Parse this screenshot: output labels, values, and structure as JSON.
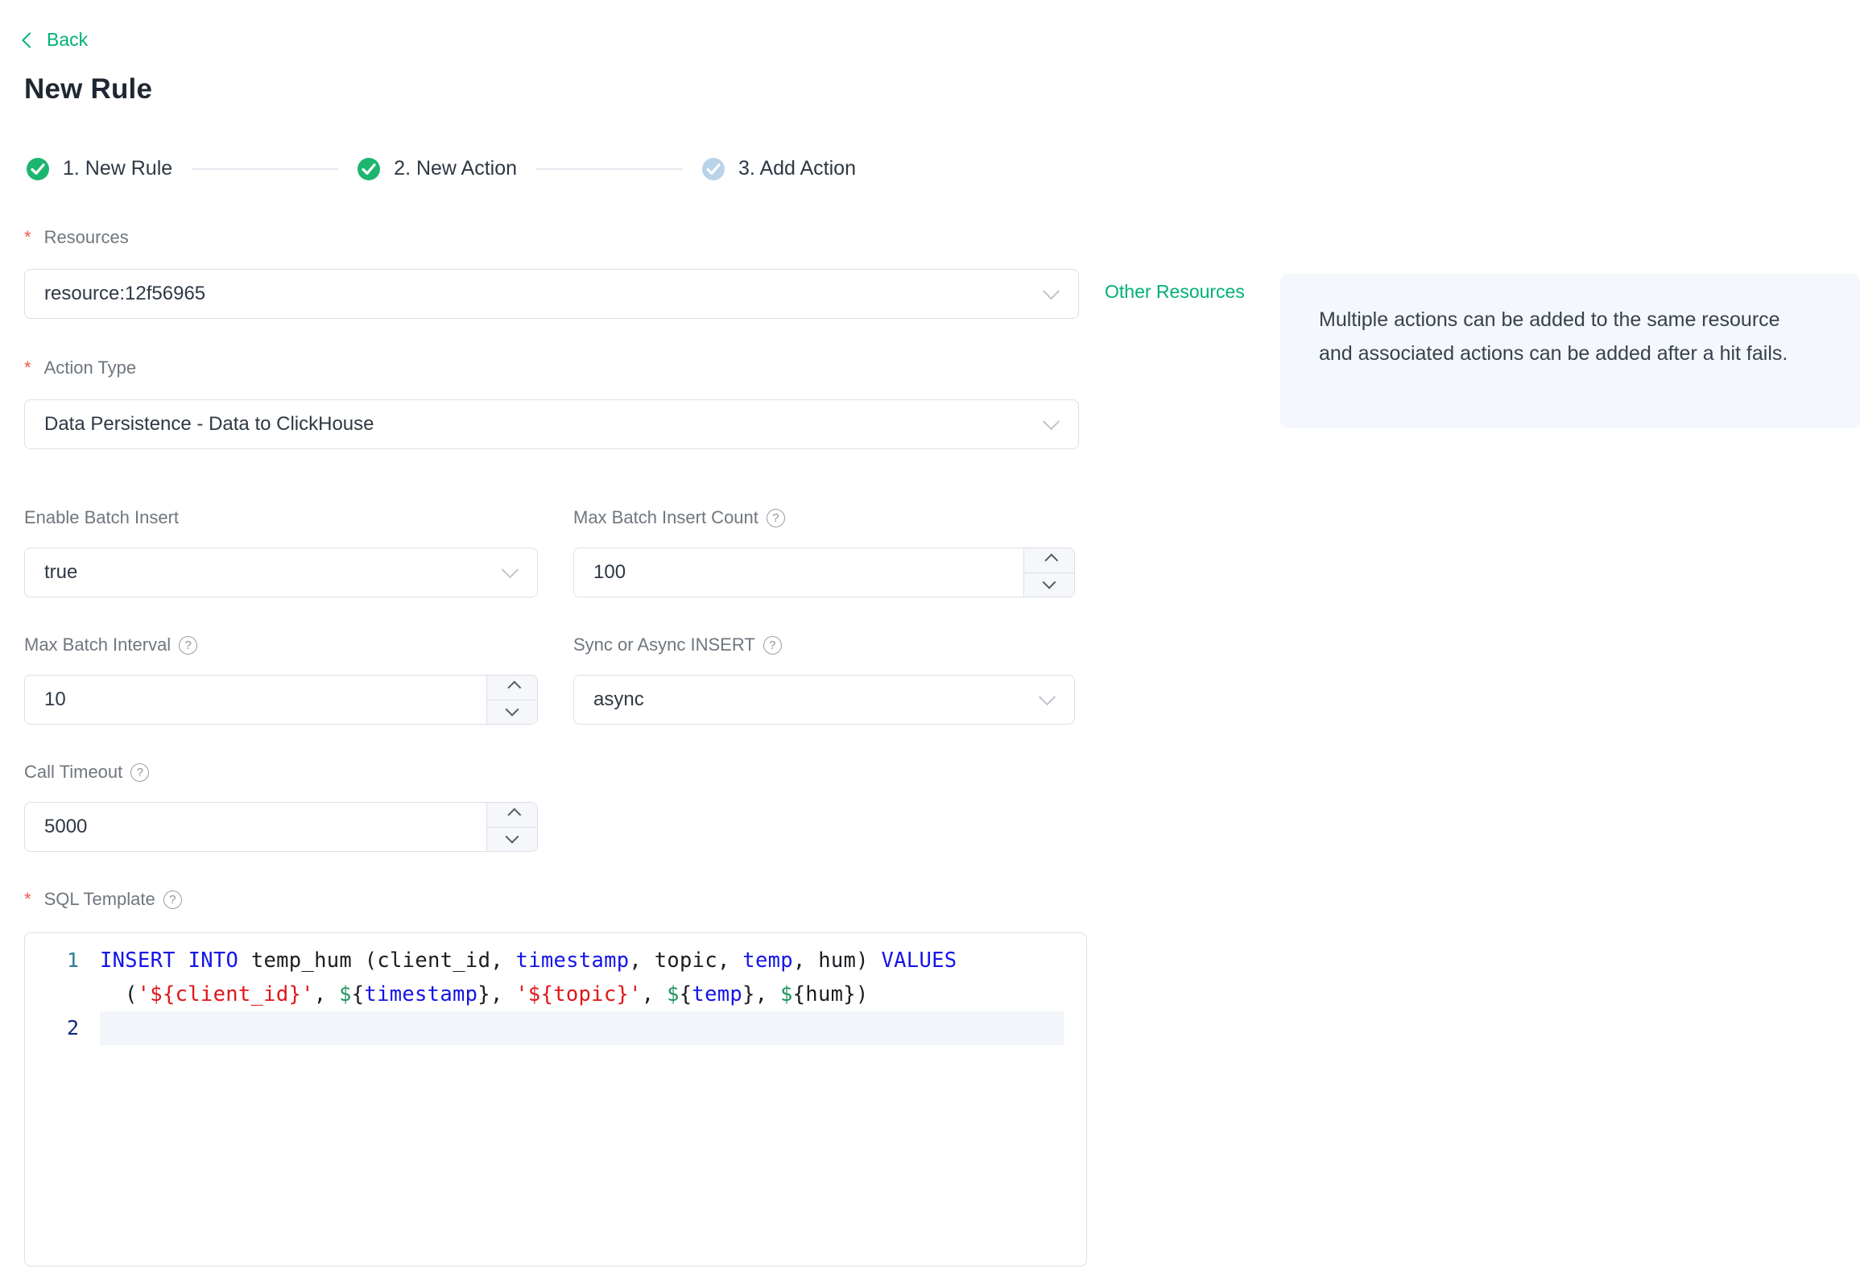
{
  "colors": {
    "accent": "#00b173",
    "step_done": "#1db56f",
    "step_pending": "#b9d3e8",
    "required": "#f0574a",
    "label": "#6f767e",
    "text_dark": "#1f2732",
    "border": "#dcdfe6",
    "chevron": "#c0c4cc",
    "stepper_bg": "#f5f7fa",
    "info_bg": "#f4f7fb",
    "info_text": "#38414d",
    "code_keyword": "#1414e8",
    "code_string": "#e01619",
    "code_variable": "#23945f",
    "code_text": "#1a1d21",
    "line_number": "#2f7f95",
    "line_number_active": "#10297a",
    "active_line_bg": "#f2f6fa"
  },
  "header": {
    "back_label": "Back",
    "title": "New Rule"
  },
  "steps": [
    {
      "label": "1. New Rule",
      "state": "done"
    },
    {
      "label": "2. New Action",
      "state": "done"
    },
    {
      "label": "3. Add Action",
      "state": "pending"
    }
  ],
  "form": {
    "resources": {
      "label": "Resources",
      "value": "resource:12f56965",
      "other_link": "Other Resources"
    },
    "info_box": {
      "text": "Multiple actions can be added to the same resource and associated actions can be added after a hit fails."
    },
    "action_type": {
      "label": "Action Type",
      "value": "Data Persistence - Data to ClickHouse"
    },
    "enable_batch_insert": {
      "label": "Enable Batch Insert",
      "value": "true"
    },
    "max_batch_insert_count": {
      "label": "Max Batch Insert Count",
      "value": "100"
    },
    "max_batch_interval": {
      "label": "Max Batch Interval",
      "value": "10"
    },
    "sync_async": {
      "label": "Sync or Async INSERT",
      "value": "async"
    },
    "call_timeout": {
      "label": "Call Timeout",
      "value": "5000"
    },
    "sql_template": {
      "label": "SQL Template"
    }
  },
  "sql_editor": {
    "rows": [
      {
        "gutter": "1",
        "gutter_class": "ln-default",
        "wrap": false,
        "active": false,
        "tokens": [
          [
            "kw",
            "INSERT INTO"
          ],
          [
            "pl",
            " temp_hum (client_id, "
          ],
          [
            "kw",
            "timestamp"
          ],
          [
            "pl",
            ", topic, "
          ],
          [
            "kw",
            "temp"
          ],
          [
            "pl",
            ", hum) "
          ],
          [
            "kw",
            "VALUES"
          ]
        ]
      },
      {
        "gutter": "",
        "gutter_class": "ln-default",
        "wrap": true,
        "active": false,
        "tokens": [
          [
            "pl",
            "("
          ],
          [
            "str",
            "'${client_id}'"
          ],
          [
            "pl",
            ", "
          ],
          [
            "dollar",
            "$"
          ],
          [
            "pl",
            "{"
          ],
          [
            "kw",
            "timestamp"
          ],
          [
            "pl",
            "}, "
          ],
          [
            "str",
            "'${topic}'"
          ],
          [
            "pl",
            ", "
          ],
          [
            "dollar",
            "$"
          ],
          [
            "pl",
            "{"
          ],
          [
            "kw",
            "temp"
          ],
          [
            "pl",
            "}, "
          ],
          [
            "dollar",
            "$"
          ],
          [
            "pl",
            "{hum})"
          ]
        ]
      },
      {
        "gutter": "2",
        "gutter_class": "ln-active",
        "wrap": false,
        "active": true,
        "tokens": []
      }
    ]
  }
}
